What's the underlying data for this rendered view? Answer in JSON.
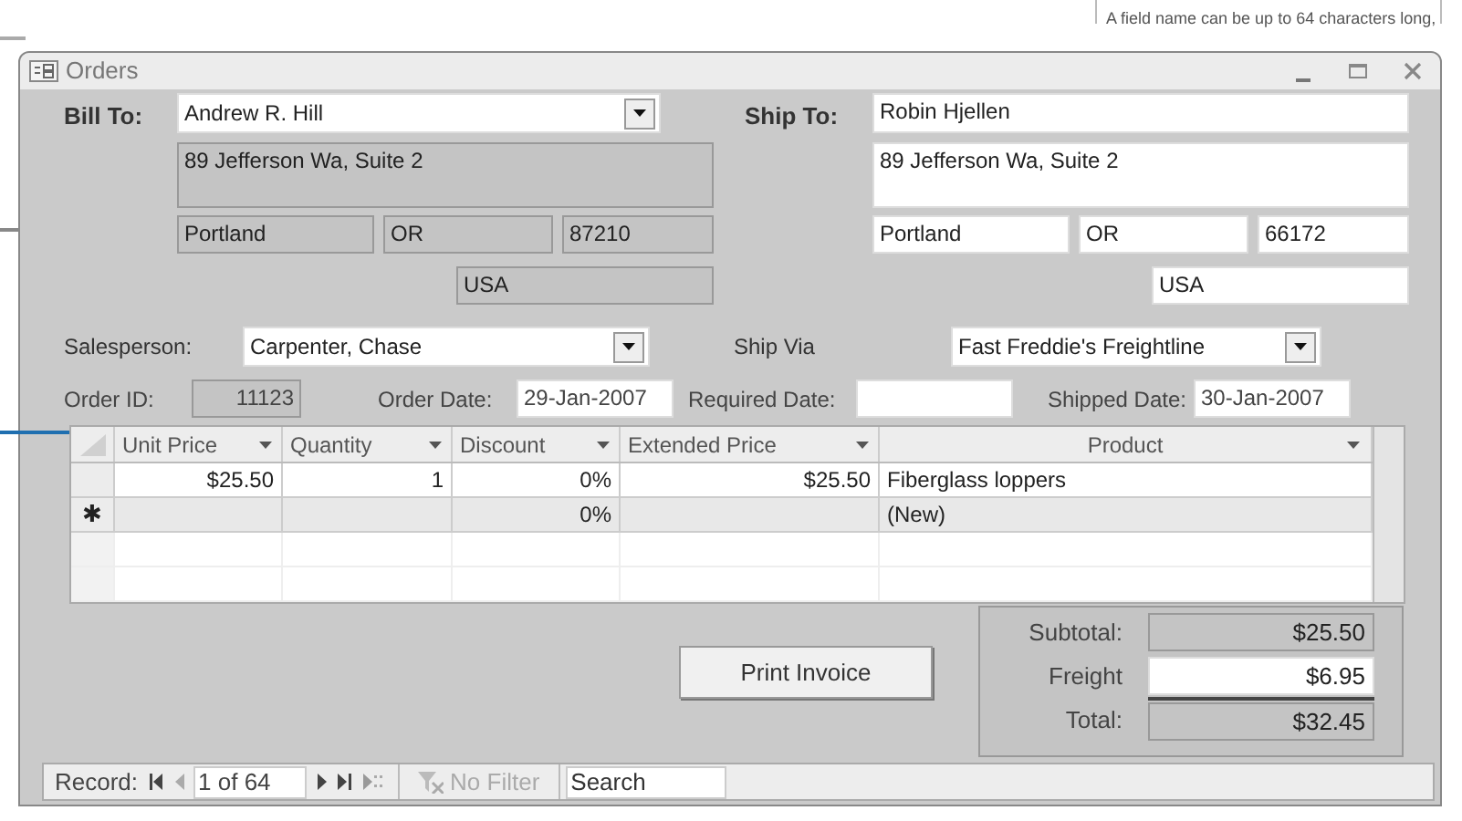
{
  "background_window": {
    "text": "A field name can be up to 64 characters long,"
  },
  "window": {
    "title": "Orders"
  },
  "bill_to": {
    "label": "Bill To:",
    "locked": true,
    "name": "Andrew R. Hill",
    "address": "89 Jefferson Wa, Suite 2",
    "city": "Portland",
    "state": "OR",
    "zip": "87210",
    "country": "USA"
  },
  "ship_to": {
    "label": "Ship To:",
    "locked": false,
    "name": "Robin Hjellen",
    "address": "89 Jefferson Wa, Suite 2",
    "city": "Portland",
    "state": "OR",
    "zip": "66172",
    "country": "USA"
  },
  "salesperson": {
    "label": "Salesperson:",
    "value": "Carpenter, Chase"
  },
  "ship_via": {
    "label": "Ship Via",
    "value": "Fast Freddie's Freightline"
  },
  "order_id": {
    "label": "Order ID:",
    "value": "11123"
  },
  "order_date": {
    "label": "Order Date:",
    "value": "29-Jan-2007"
  },
  "required_date": {
    "label": "Required Date:"
  },
  "shipped_date": {
    "label": "Shipped Date:",
    "value": "30-Jan-2007"
  },
  "grid": {
    "columns": [
      {
        "label": "Unit Price"
      },
      {
        "label": "Quantity"
      },
      {
        "label": "Discount"
      },
      {
        "label": "Extended Price"
      },
      {
        "label": "Product"
      }
    ],
    "rows": [
      {
        "kind": "record",
        "unit_price": "$25.50",
        "quantity": "1",
        "discount": "0%",
        "extended_price": "$25.50",
        "product": "Fiberglass loppers"
      },
      {
        "kind": "new",
        "marker": "✱",
        "discount": "0%",
        "product": "(New)"
      }
    ]
  },
  "print_button": "Print Invoice",
  "totals": [
    {
      "kind": "subtotal",
      "label": "Subtotal:",
      "value": "$25.50"
    },
    {
      "kind": "input",
      "label": "Freight",
      "value": "$6.95"
    },
    {
      "kind": "total",
      "label": "Total:",
      "value": "$32.45"
    }
  ],
  "navigation": {
    "label": "Record:",
    "position": "1 of 64",
    "filter": "No Filter",
    "search_placeholder": "Search"
  }
}
